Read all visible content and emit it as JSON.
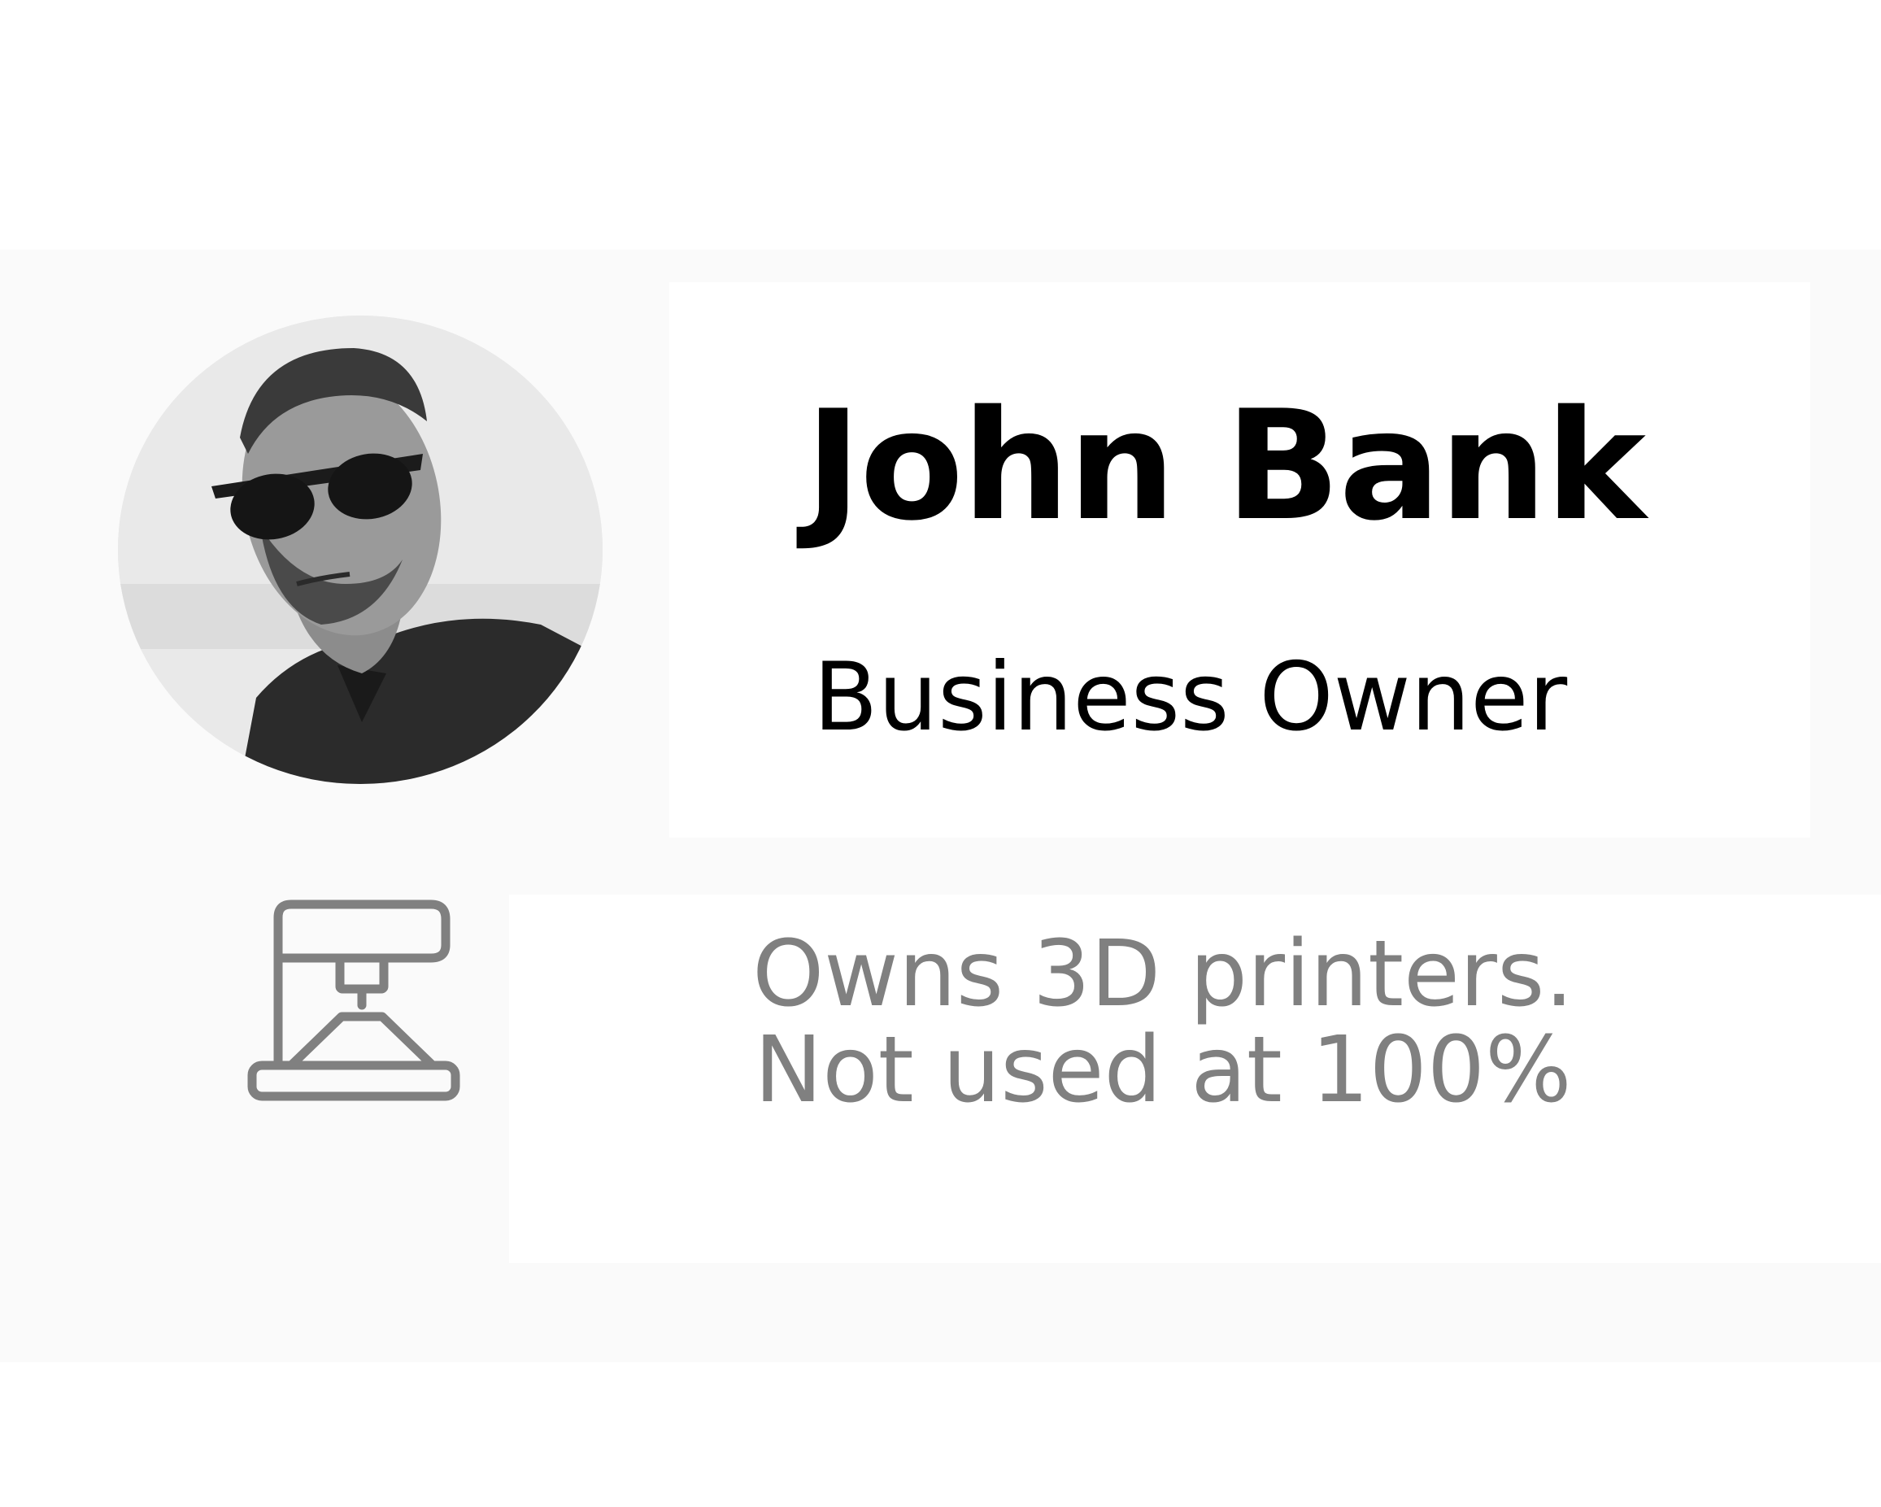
{
  "profile": {
    "name": "John Bank",
    "role": "Business Owner"
  },
  "note": {
    "line1": "Owns 3D printers.",
    "line2": "Not used at 100%"
  },
  "icons": {
    "printer": "3d-printer-icon"
  },
  "colors": {
    "background": "#ffffff",
    "card": "#fafafa",
    "panel": "#ffffff",
    "name_text": "#000000",
    "note_text": "#808080",
    "icon_stroke": "#808080"
  }
}
